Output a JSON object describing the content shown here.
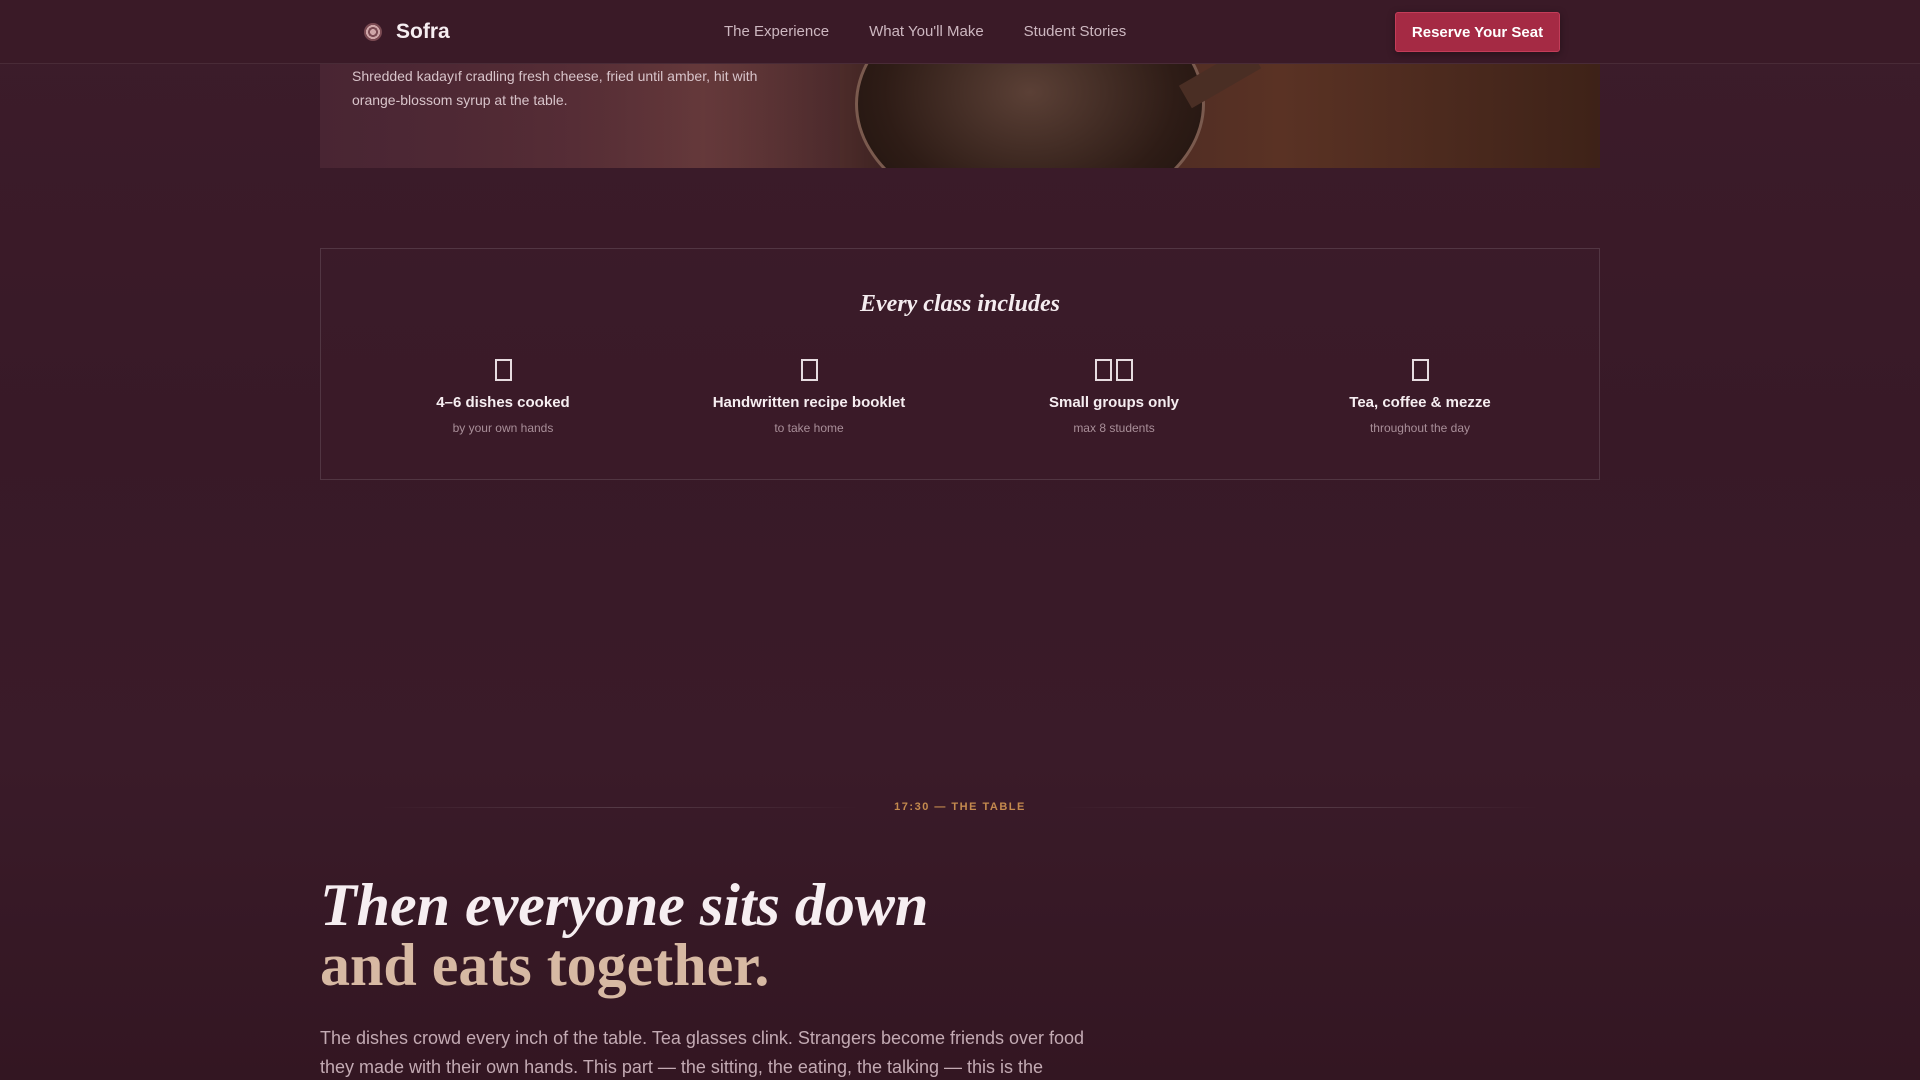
{
  "nav": {
    "brand": "Sofra",
    "links": [
      "The Experience",
      "What You'll Make",
      "Student Stories"
    ],
    "cta": "Reserve Your Seat"
  },
  "hero": {
    "caption": "Shredded kadayıf cradling fresh cheese, fried until amber, hit with orange-blossom syrup at the table."
  },
  "includes": {
    "title": "Every class includes",
    "items": [
      {
        "icon": "pot-icon",
        "title": "4–6 dishes cooked",
        "sub": "by your own hands"
      },
      {
        "icon": "book-icon",
        "title": "Handwritten recipe booklet",
        "sub": "to take home"
      },
      {
        "icon": "people-icon",
        "title": "Small groups only",
        "sub": "max 8 students"
      },
      {
        "icon": "tea-icon",
        "title": "Tea, coffee & mezze",
        "sub": "throughout the day"
      }
    ]
  },
  "table_section": {
    "label": "17:30 — THE TABLE",
    "heading_line1": "Then everyone sits down",
    "heading_line2": "and eats together.",
    "body": "The dishes crowd every inch of the table. Tea glasses clink. Strangers become friends over food they made with their own hands. This part — the sitting, the eating, the talking — this is the"
  }
}
